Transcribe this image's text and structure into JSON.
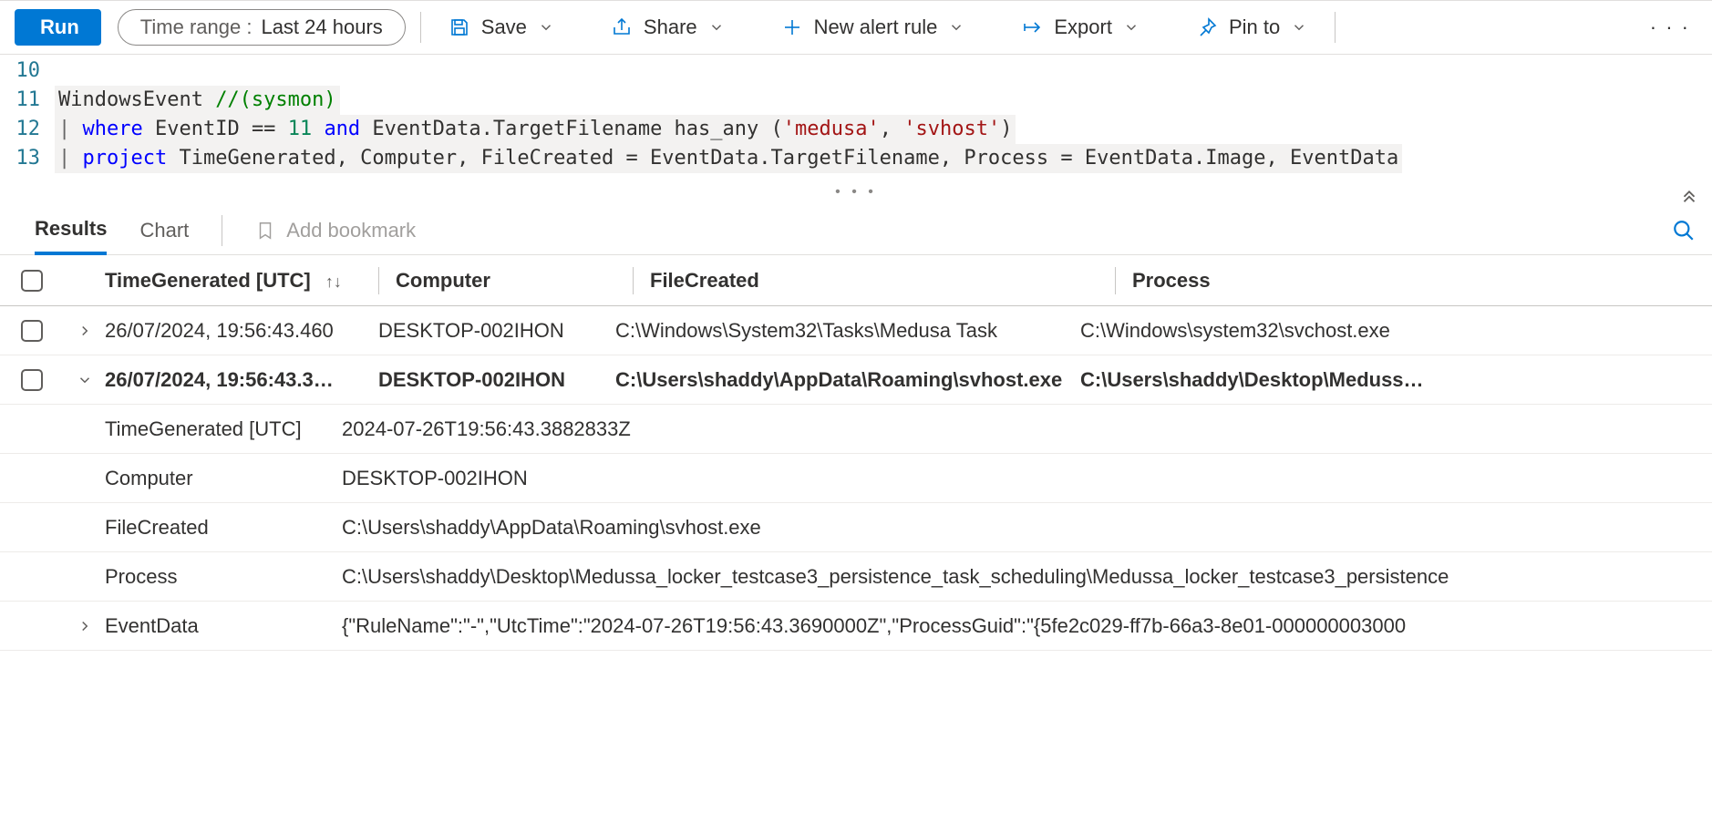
{
  "toolbar": {
    "run": "Run",
    "timerange_label": "Time range :",
    "timerange_value": "Last 24 hours",
    "save": "Save",
    "share": "Share",
    "new_alert": "New alert rule",
    "export": "Export",
    "pin_to": "Pin to",
    "more": "· · ·"
  },
  "editor": {
    "lines": [
      {
        "num": "10",
        "tokens": []
      },
      {
        "num": "11",
        "tokens": [
          {
            "t": "WindowsEvent ",
            "c": "tok-ident"
          },
          {
            "t": "//(sysmon)",
            "c": "tok-comment"
          }
        ]
      },
      {
        "num": "12",
        "tokens": [
          {
            "t": "| ",
            "c": "tok-pipe"
          },
          {
            "t": "where",
            "c": "tok-kw"
          },
          {
            "t": " EventID == ",
            "c": "tok-ident"
          },
          {
            "t": "11",
            "c": "tok-num"
          },
          {
            "t": " ",
            "c": ""
          },
          {
            "t": "and",
            "c": "tok-kw"
          },
          {
            "t": " EventData.TargetFilename has_any (",
            "c": "tok-ident"
          },
          {
            "t": "'medusa'",
            "c": "tok-str"
          },
          {
            "t": ", ",
            "c": "tok-ident"
          },
          {
            "t": "'svhost'",
            "c": "tok-str"
          },
          {
            "t": ")",
            "c": "tok-ident"
          }
        ]
      },
      {
        "num": "13",
        "tokens": [
          {
            "t": "| ",
            "c": "tok-pipe"
          },
          {
            "t": "project",
            "c": "tok-kw"
          },
          {
            "t": " TimeGenerated, Computer, FileCreated = EventData.TargetFilename, Process = EventData.Image, EventData",
            "c": "tok-ident"
          }
        ]
      }
    ]
  },
  "tabs": {
    "results": "Results",
    "chart": "Chart",
    "bookmark": "Add bookmark"
  },
  "grid": {
    "headers": {
      "time": "TimeGenerated [UTC]",
      "computer": "Computer",
      "file": "FileCreated",
      "process": "Process"
    },
    "rows": [
      {
        "expanded": false,
        "time": "26/07/2024, 19:56:43.460",
        "computer": "DESKTOP-002IHON",
        "file": "C:\\Windows\\System32\\Tasks\\Medusa Task",
        "process": "C:\\Windows\\system32\\svchost.exe"
      },
      {
        "expanded": true,
        "bold": true,
        "time": "26/07/2024, 19:56:43.3…",
        "computer": "DESKTOP-002IHON",
        "file": "C:\\Users\\shaddy\\AppData\\Roaming\\svhost.exe",
        "process": "C:\\Users\\shaddy\\Desktop\\Meduss…"
      }
    ],
    "detail": [
      {
        "key": "TimeGenerated [UTC]",
        "val": "2024-07-26T19:56:43.3882833Z",
        "expandable": false
      },
      {
        "key": "Computer",
        "val": "DESKTOP-002IHON",
        "expandable": false
      },
      {
        "key": "FileCreated",
        "val": "C:\\Users\\shaddy\\AppData\\Roaming\\svhost.exe",
        "expandable": false
      },
      {
        "key": "Process",
        "val": "C:\\Users\\shaddy\\Desktop\\Medussa_locker_testcase3_persistence_task_scheduling\\Medussa_locker_testcase3_persistence",
        "expandable": false
      },
      {
        "key": "EventData",
        "val": "{\"RuleName\":\"-\",\"UtcTime\":\"2024-07-26T19:56:43.3690000Z\",\"ProcessGuid\":\"{5fe2c029-ff7b-66a3-8e01-000000003000",
        "expandable": true
      }
    ]
  }
}
